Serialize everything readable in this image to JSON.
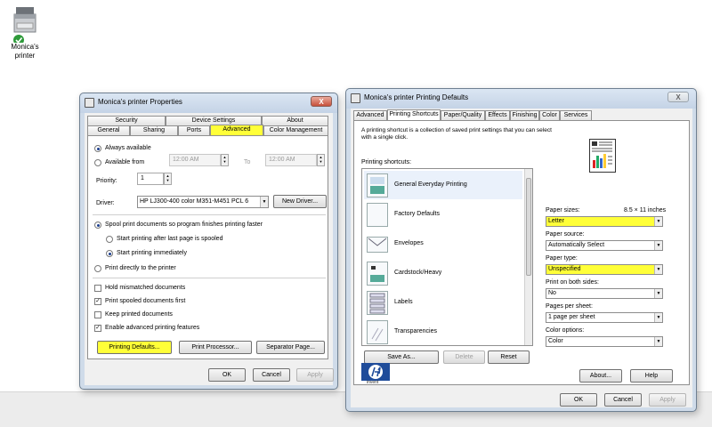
{
  "desktop": {
    "printer_icon_label_line1": "Monica's",
    "printer_icon_label_line2": "printer"
  },
  "props_window": {
    "title": "Monica's printer Properties",
    "close": "X",
    "tabs_row1": [
      "Security",
      "Device Settings",
      "About"
    ],
    "tabs_row2": [
      "General",
      "Sharing",
      "Ports",
      "Advanced",
      "Color Management"
    ],
    "always_available": "Always available",
    "available_from": "Available from",
    "from_time": "12:00 AM",
    "to_label": "To",
    "to_time": "12:00 AM",
    "priority_label": "Priority:",
    "priority_value": "1",
    "driver_label": "Driver:",
    "driver_value": "HP LJ300-400 color M351-M451 PCL 6",
    "new_driver": "New Driver...",
    "spool": "Spool print documents so program finishes printing faster",
    "start_after_last": "Start printing after last page is spooled",
    "start_immediately": "Start printing immediately",
    "print_directly": "Print directly to the printer",
    "hold_mismatched": "Hold mismatched documents",
    "print_spooled_first": "Print spooled documents first",
    "keep_printed": "Keep printed documents",
    "enable_advanced": "Enable advanced printing features",
    "printing_defaults": "Printing Defaults...",
    "print_processor": "Print Processor...",
    "separator_page": "Separator Page...",
    "ok": "OK",
    "cancel": "Cancel",
    "apply": "Apply"
  },
  "defaults_window": {
    "title": "Monica's printer Printing Defaults",
    "close": "X",
    "tabs": [
      "Advanced",
      "Printing Shortcuts",
      "Paper/Quality",
      "Effects",
      "Finishing",
      "Color",
      "Services"
    ],
    "description_line1": "A printing shortcut is a collection of saved print settings that you can select",
    "description_line2": "with a single click.",
    "shortcuts_label": "Printing shortcuts:",
    "shortcuts": [
      "General Everyday Printing",
      "Factory Defaults",
      "Envelopes",
      "Cardstock/Heavy",
      "Labels",
      "Transparencies"
    ],
    "save_as": "Save As...",
    "delete": "Delete",
    "reset": "Reset",
    "paper_sizes_label": "Paper sizes:",
    "paper_sizes_dims": "8.5 × 11 inches",
    "paper_sizes_value": "Letter",
    "paper_source_label": "Paper source:",
    "paper_source_value": "Automatically Select",
    "paper_type_label": "Paper type:",
    "paper_type_value": "Unspecified",
    "both_sides_label": "Print on both sides:",
    "both_sides_value": "No",
    "pages_per_sheet_label": "Pages per sheet:",
    "pages_per_sheet_value": "1 page per sheet",
    "color_options_label": "Color options:",
    "color_options_value": "Color",
    "about": "About...",
    "help": "Help",
    "hp_tagline": "invent",
    "ok": "OK",
    "cancel": "Cancel",
    "apply": "Apply"
  },
  "colors": {
    "highlight": "#ffff38",
    "title_bar": "#cfdbe9",
    "close_red": "#c7503a"
  }
}
